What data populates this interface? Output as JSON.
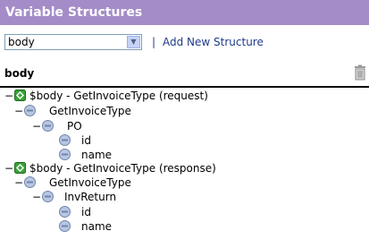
{
  "window": {
    "title": "Variable Structures"
  },
  "toolbar": {
    "selected_structure": "body",
    "separator": "|",
    "add_link": "Add New Structure"
  },
  "structure_header": {
    "label": "body"
  },
  "tree": {
    "collapse_glyph": "−",
    "root_request": "$body - GetInvoiceType (request)",
    "request_type": "GetInvoiceType",
    "request_po": "PO",
    "request_po_id": "id",
    "request_po_name": "name",
    "root_response": "$body - GetInvoiceType (response)",
    "response_type": "GetInvoiceType",
    "response_invreturn": "InvReturn",
    "response_invreturn_id": "id",
    "response_invreturn_name": "name"
  },
  "colors": {
    "title_bar": "#a48cc8",
    "link": "#1f3a8c",
    "node_root": "#3aa23a",
    "node_element": "#8ea2c7"
  },
  "icons": {
    "dropdown": "chevron-down-icon",
    "delete": "trash-icon",
    "root_node": "root-node-icon",
    "element_node": "element-node-icon"
  }
}
